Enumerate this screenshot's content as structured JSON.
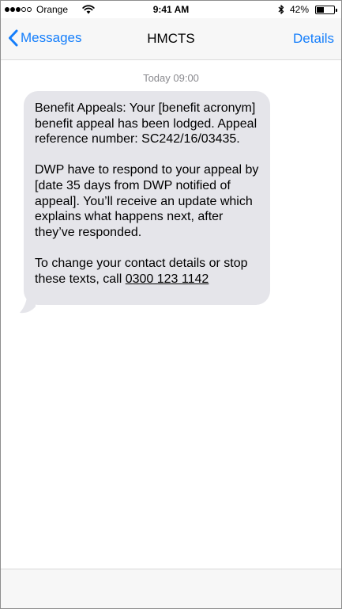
{
  "status_bar": {
    "signal_filled": 3,
    "signal_total": 5,
    "carrier": "Orange",
    "time": "9:41 AM",
    "battery_percent": "42%",
    "battery_level": 0.42,
    "icons": [
      "signal-dots",
      "wifi-icon",
      "bluetooth-icon",
      "battery-icon"
    ]
  },
  "nav": {
    "back_label": "Messages",
    "title": "HMCTS",
    "details_label": "Details",
    "accent_color": "#147efb"
  },
  "conversation": {
    "timestamp": "Today 09:00",
    "message": {
      "paragraph_1": "Benefit Appeals: Your [benefit acronym] benefit appeal has been lodged. Appeal reference number: SC242/16/03435.",
      "paragraph_2": "DWP have to respond to your appeal by [date 35 days from DWP notified of appeal]. You’ll receive an update which explains what happens next, after they’ve responded.",
      "paragraph_3_prefix": "To change your contact details or stop these texts, call ",
      "phone_number": "0300 123 1142",
      "bubble_color": "#e5e5ea"
    }
  }
}
